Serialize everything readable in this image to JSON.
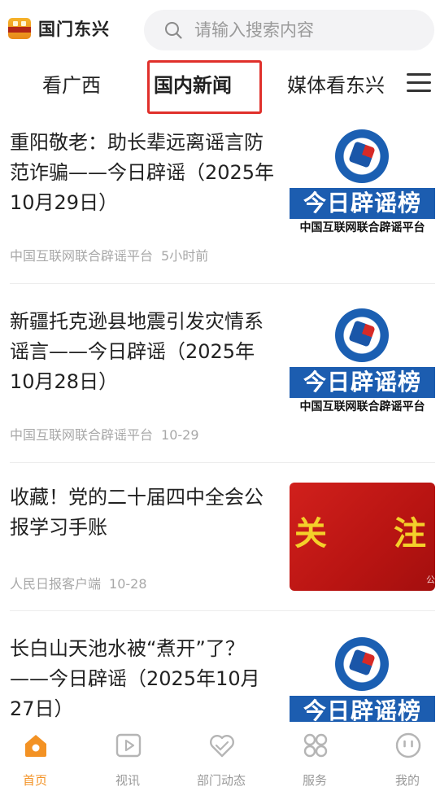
{
  "header": {
    "app_name": "国门东兴",
    "search_placeholder": "请输入搜索内容"
  },
  "tabs": [
    {
      "label": "看广西"
    },
    {
      "label": "国内新闻"
    },
    {
      "label": "媒体看东兴"
    }
  ],
  "feed": [
    {
      "title": "重阳敬老：助长辈远离谣言防范诈骗——今日辟谣（2025年10月29日）",
      "source": "中国互联网联合辟谣平台",
      "time": "5小时前",
      "thumb": {
        "banner": "今日辟谣榜",
        "subtitle": "中国互联网联合辟谣平台"
      }
    },
    {
      "title": "新疆托克逊县地震引发灾情系谣言——今日辟谣（2025年10月28日）",
      "source": "中国互联网联合辟谣平台",
      "time": "10-29",
      "thumb": {
        "banner": "今日辟谣榜",
        "subtitle": "中国互联网联合辟谣平台"
      }
    },
    {
      "title": "收藏！党的二十届四中全会公报学习手账",
      "source": "人民日报客户端",
      "time": "10-28",
      "thumb": {
        "word_left": "关",
        "word_right": "注",
        "watermark": "公"
      }
    },
    {
      "title": "长白山天池水被“煮开”了？——今日辟谣（2025年10月27日）",
      "thumb": {
        "banner": "今日辟谣榜"
      }
    }
  ],
  "bottom_nav": [
    {
      "label": "首页"
    },
    {
      "label": "视讯"
    },
    {
      "label": "部门动态"
    },
    {
      "label": "服务"
    },
    {
      "label": "我的"
    }
  ],
  "colors": {
    "accent": "#f39224",
    "highlight_box": "#e0302b",
    "thumb_blue": "#1c5db0",
    "thumb_red": "#c41a17"
  }
}
